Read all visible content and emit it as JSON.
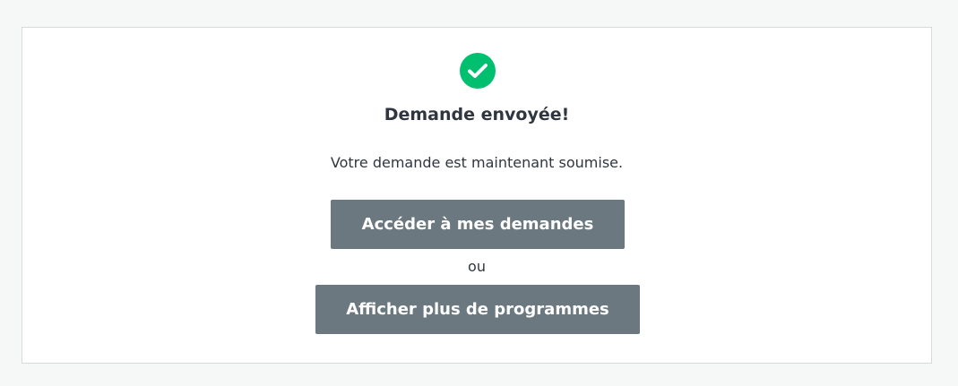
{
  "confirmation": {
    "icon": "check-circle-icon",
    "accent_color": "#00bf6f",
    "title": "Demande envoyée!",
    "message": "Votre demande est maintenant soumise."
  },
  "actions": {
    "requests_label": "Accéder à mes demandes",
    "separator": "ou",
    "programs_label": "Afficher plus de programmes",
    "button_color": "#6b787f"
  }
}
